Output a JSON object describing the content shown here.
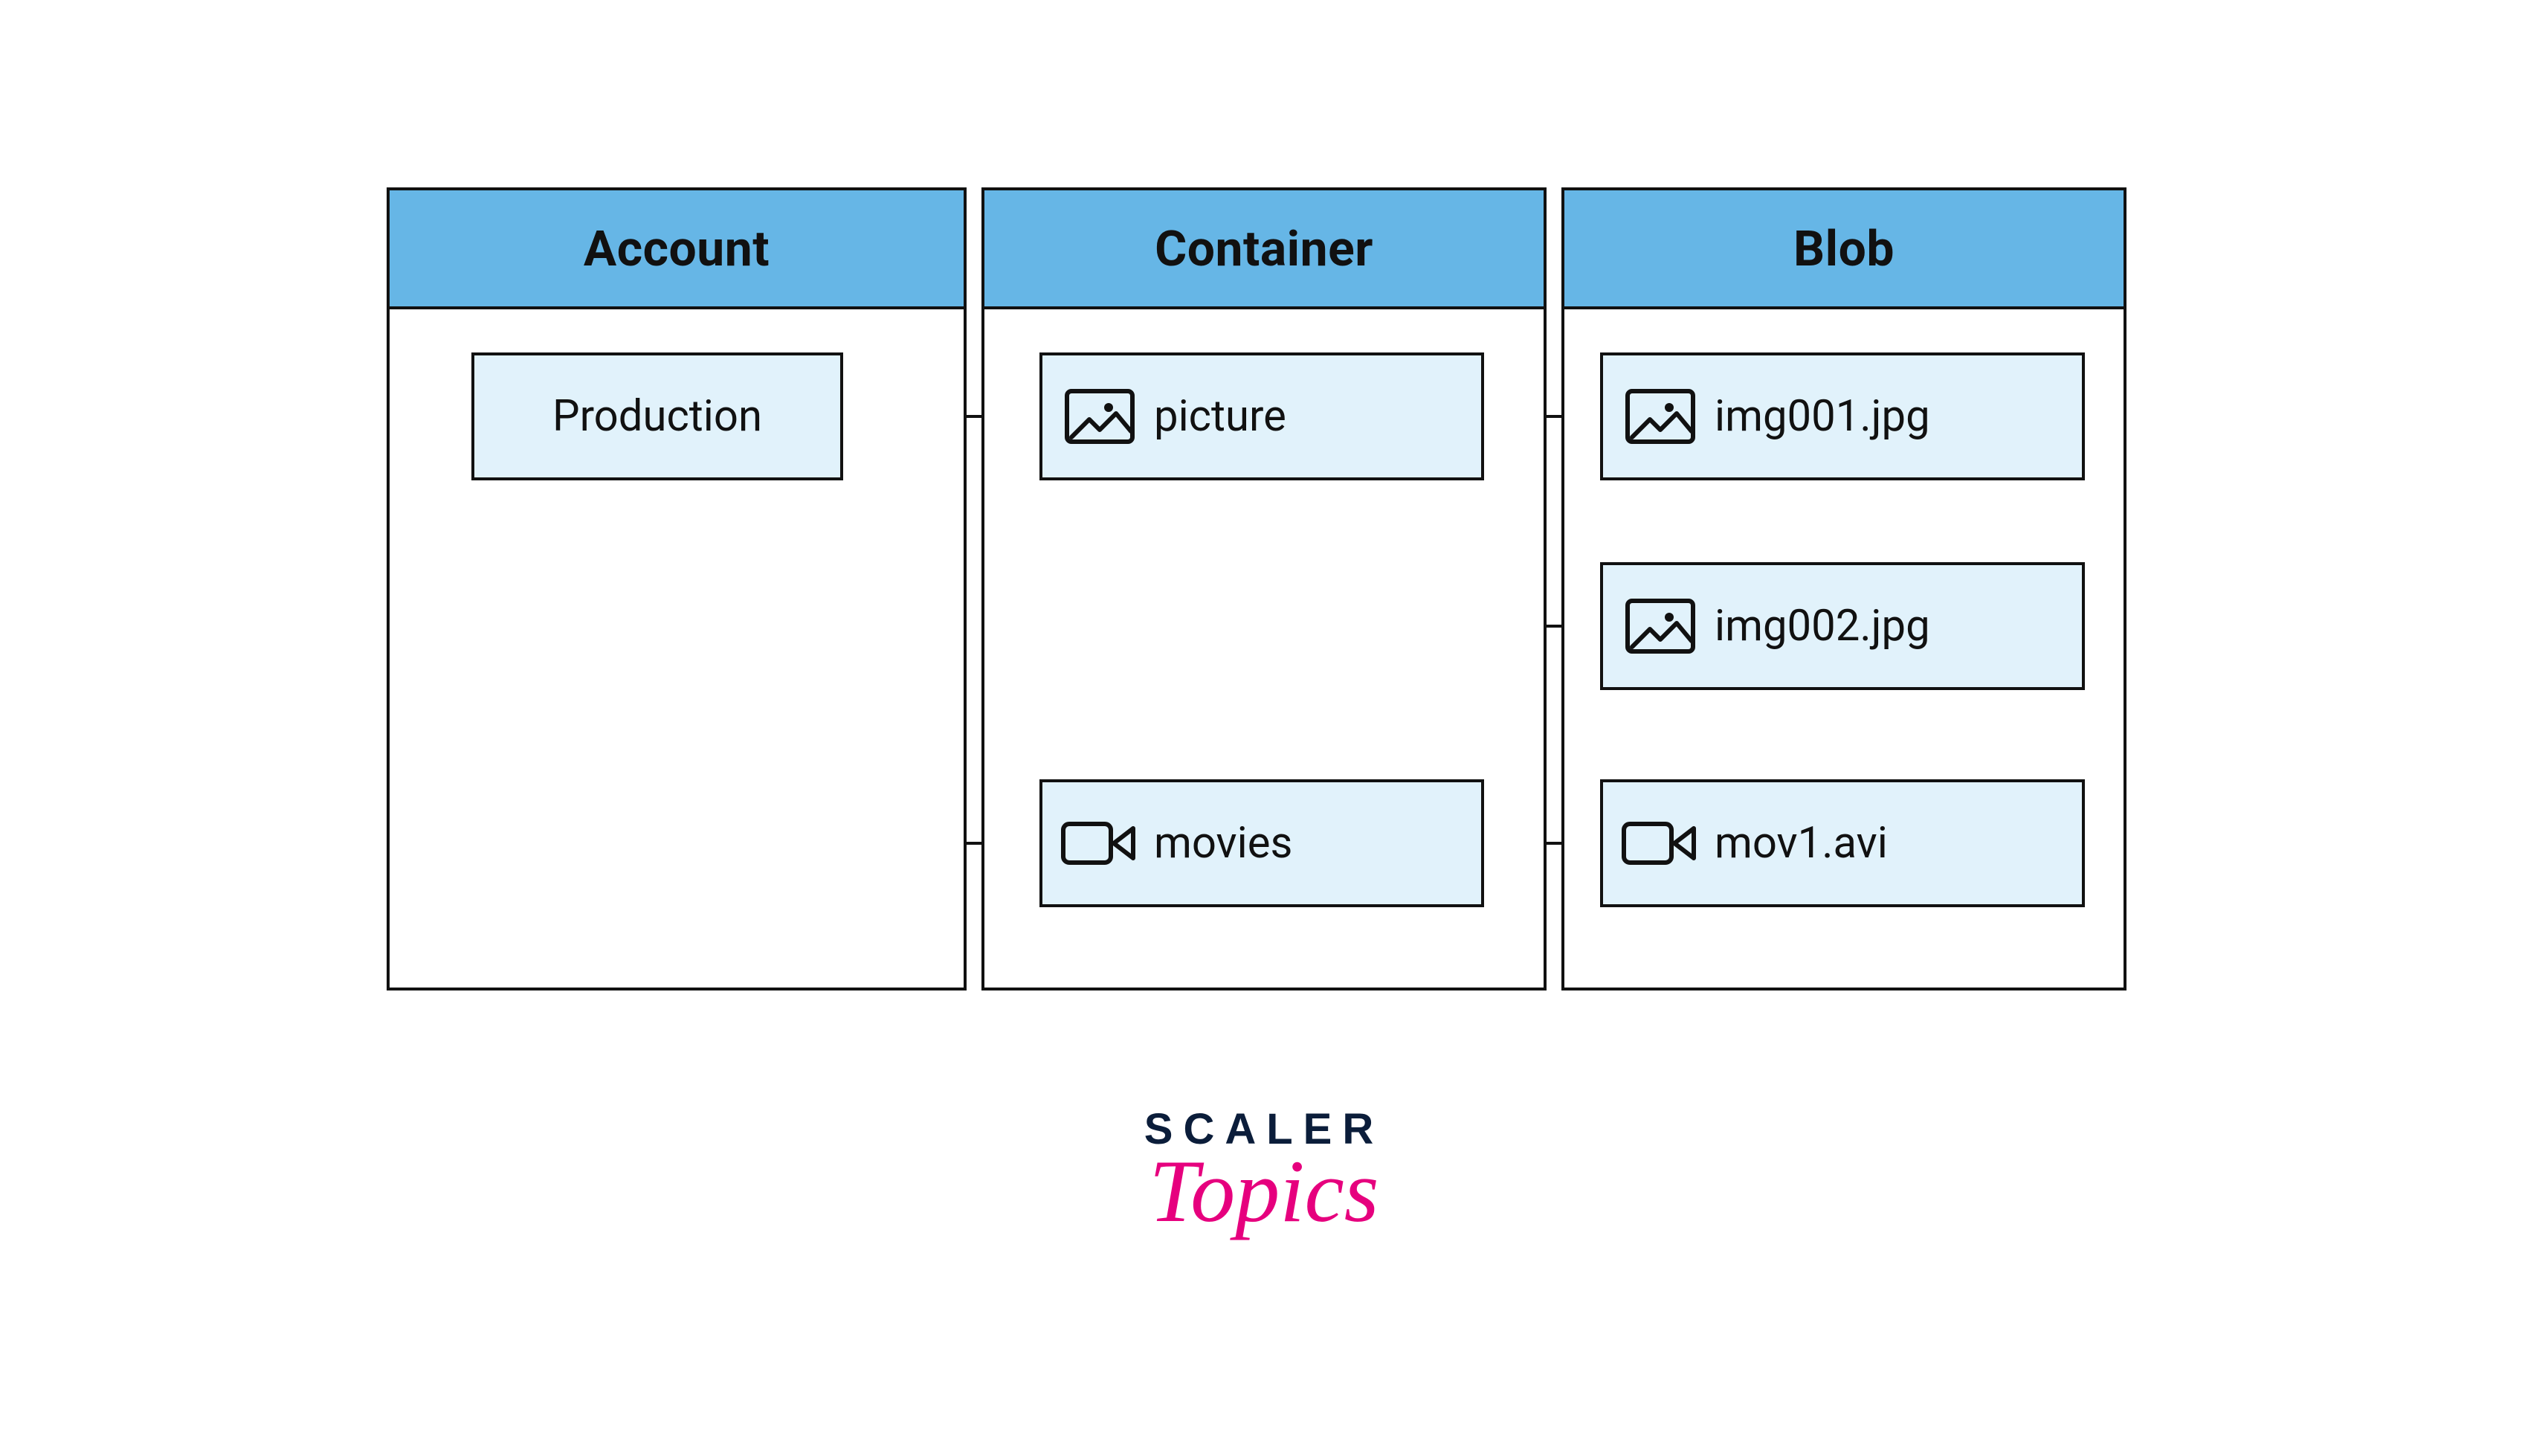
{
  "columns": {
    "account": {
      "title": "Account"
    },
    "container": {
      "title": "Container"
    },
    "blob": {
      "title": "Blob"
    }
  },
  "nodes": {
    "production": {
      "label": "Production",
      "icon": null
    },
    "picture": {
      "label": "picture",
      "icon": "image"
    },
    "movies": {
      "label": "movies",
      "icon": "video"
    },
    "img001": {
      "label": "img001.jpg",
      "icon": "image"
    },
    "img002": {
      "label": "img002.jpg",
      "icon": "image"
    },
    "mov1": {
      "label": "mov1.avi",
      "icon": "video"
    }
  },
  "logo": {
    "line1": "SCALER",
    "line2": "Topics"
  },
  "colors": {
    "header_bg": "#66B6E6",
    "node_bg": "#E1F2FB",
    "stroke": "#111111",
    "logo_dark": "#0B1D3A",
    "logo_pink": "#E6007E"
  }
}
